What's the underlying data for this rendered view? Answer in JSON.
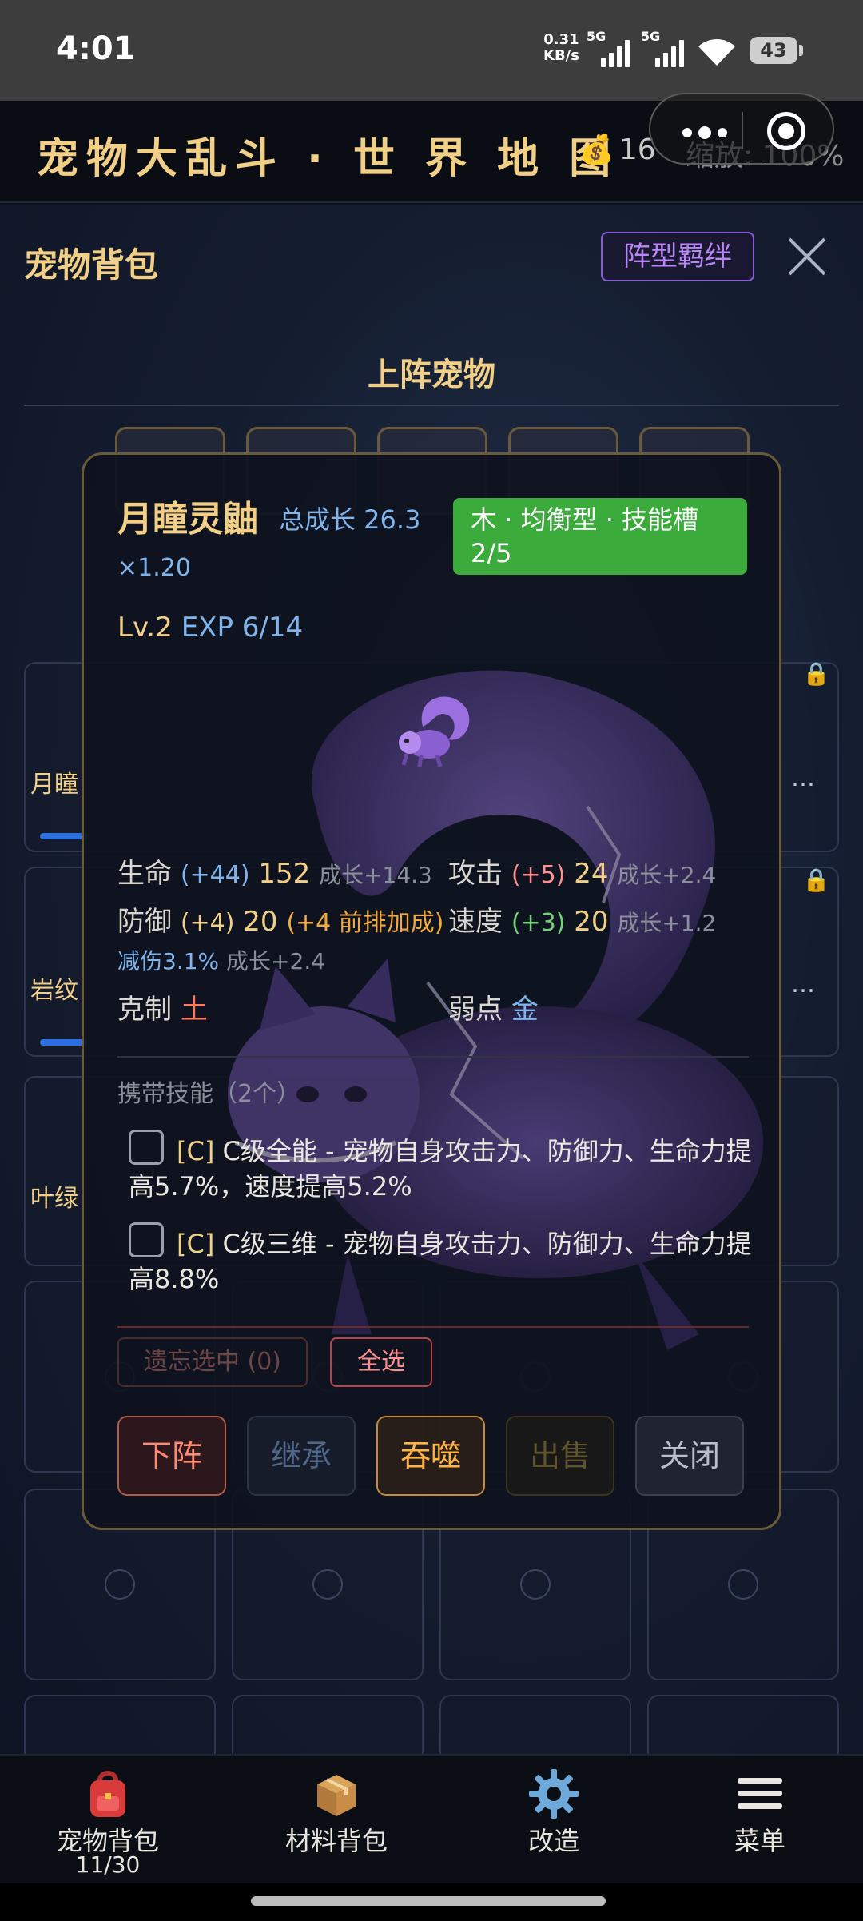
{
  "status_bar": {
    "time": "4:01",
    "net_speed_value": "0.31",
    "net_speed_unit": "KB/s",
    "sim1": "5G",
    "sim2": "5G",
    "battery": "43"
  },
  "header": {
    "title": "宠物大乱斗 · 世 界 地 图",
    "coins": "16",
    "zoom": "缩放: 100%"
  },
  "panel": {
    "title": "宠物背包",
    "formation_button": "阵型羁绊",
    "section_title": "上阵宠物",
    "peek_names": [
      "月瞳",
      "岩纹",
      "叶绿"
    ]
  },
  "pet_modal": {
    "name": "月瞳灵鼬",
    "growth": "总成长 26.3",
    "multiplier": "×1.20",
    "tag": "木 · 均衡型 · 技能槽 2/5",
    "level": "Lv.2",
    "exp": "EXP 6/14",
    "stats": {
      "hp": {
        "label": "生命",
        "bonus": "(+44)",
        "value": "152",
        "growth": "成长+14.3"
      },
      "atk": {
        "label": "攻击",
        "bonus": "(+5)",
        "value": "24",
        "growth": "成长+2.4"
      },
      "def": {
        "label": "防御",
        "bonus": "(+4)",
        "value": "20",
        "front": "(+4 前排加成)"
      },
      "spd": {
        "label": "速度",
        "bonus": "(+3)",
        "value": "20",
        "growth": "成长+1.2"
      }
    },
    "damage_reduction": "减伤3.1%",
    "damage_reduction_growth": "成长+2.4",
    "counters_label": "克制",
    "counters_value": "土",
    "weakness_label": "弱点",
    "weakness_value": "金",
    "skills_header": "携带技能（2个）",
    "skills": [
      {
        "grade": "[C]",
        "text": " C级全能 - 宠物自身攻击力、防御力、生命力提高5.7%，速度提高5.2%"
      },
      {
        "grade": "[C]",
        "text": " C级三维 - 宠物自身攻击力、防御力、生命力提高8.8%"
      }
    ],
    "forget_button": "遗忘选中 (0)",
    "select_all_button": "全选",
    "actions": {
      "down": "下阵",
      "inherit": "继承",
      "devour": "吞噬",
      "sell": "出售",
      "close": "关闭"
    }
  },
  "bottom_nav": [
    {
      "label": "宠物背包",
      "count": "11/30",
      "icon": "backpack-icon"
    },
    {
      "label": "材料背包",
      "icon": "box-icon"
    },
    {
      "label": "改造",
      "icon": "gear-icon"
    },
    {
      "label": "菜单",
      "icon": "menu-icon"
    }
  ]
}
